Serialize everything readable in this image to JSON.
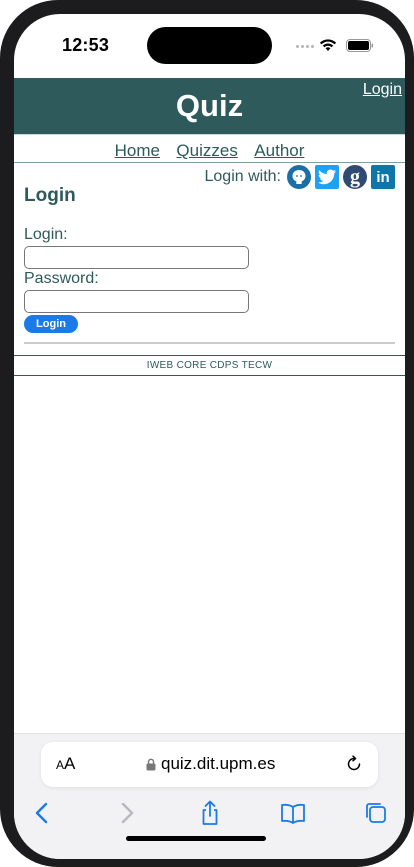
{
  "status_bar": {
    "time": "12:53"
  },
  "site": {
    "title": "Quiz",
    "header_login": "Login",
    "nav": {
      "home": "Home",
      "quizzes": "Quizzes",
      "author": "Author"
    },
    "social": {
      "label": "Login with:",
      "providers": [
        "github-icon",
        "twitter-icon",
        "google-icon",
        "linkedin-icon"
      ],
      "google_glyph": "g",
      "linkedin_glyph": "in"
    },
    "page_heading": "Login",
    "login_label": "Login:",
    "password_label": "Password:",
    "login_value": "",
    "password_value": "",
    "submit_label": "Login",
    "footer": "IWEB CORE CDPS TECW"
  },
  "browser": {
    "aa_label": "AA",
    "url": "quiz.dit.upm.es"
  },
  "colors": {
    "brand": "#2e5a5c",
    "button": "#1a7ae8",
    "safari_icons": "#1a7ae8"
  }
}
